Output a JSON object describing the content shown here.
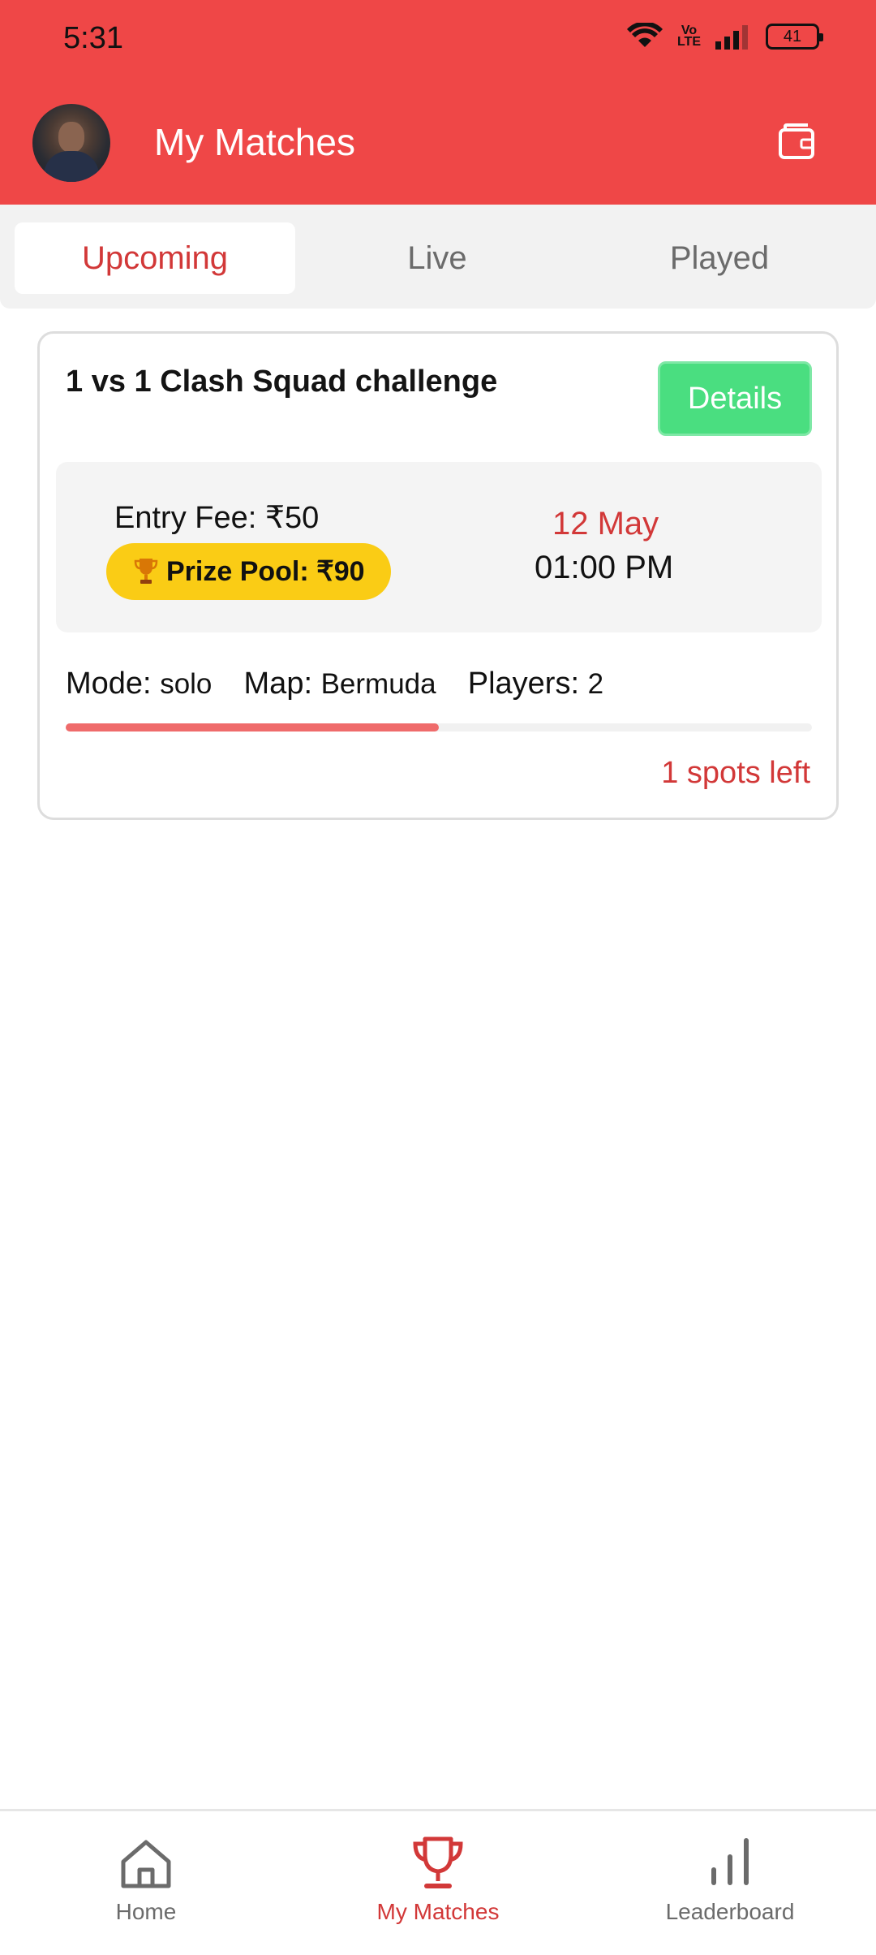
{
  "status_bar": {
    "time": "5:31",
    "volte": "Vo LTE",
    "battery": "41"
  },
  "header": {
    "title": "My Matches",
    "avatar_icon": "avatar",
    "wallet_icon": "wallet-icon"
  },
  "tabs": [
    {
      "label": "Upcoming",
      "active": true
    },
    {
      "label": "Live",
      "active": false
    },
    {
      "label": "Played",
      "active": false
    }
  ],
  "match": {
    "title": "1 vs 1 Clash Squad challenge",
    "details_label": "Details",
    "entry_fee_label": "Entry Fee:",
    "entry_fee_value": "₹50",
    "prize_pool": "Prize Pool: ₹90",
    "date": "12 May",
    "time": "01:00 PM",
    "mode_label": "Mode:",
    "mode_value": "solo",
    "map_label": "Map:",
    "map_value": "Bermuda",
    "players_label": "Players:",
    "players_value": "2",
    "slots_filled_fraction": 0.5,
    "spots_left": "1 spots left"
  },
  "bottom_nav": [
    {
      "label": "Home",
      "icon": "home-icon",
      "active": false
    },
    {
      "label": "My Matches",
      "icon": "trophy-icon",
      "active": true
    },
    {
      "label": "Leaderboard",
      "icon": "leaderboard-icon",
      "active": false
    }
  ],
  "colors": {
    "header_bg": "#ef4747",
    "accent_red": "#d23838",
    "details_green": "#4ade80",
    "prize_yellow": "#facc15"
  }
}
